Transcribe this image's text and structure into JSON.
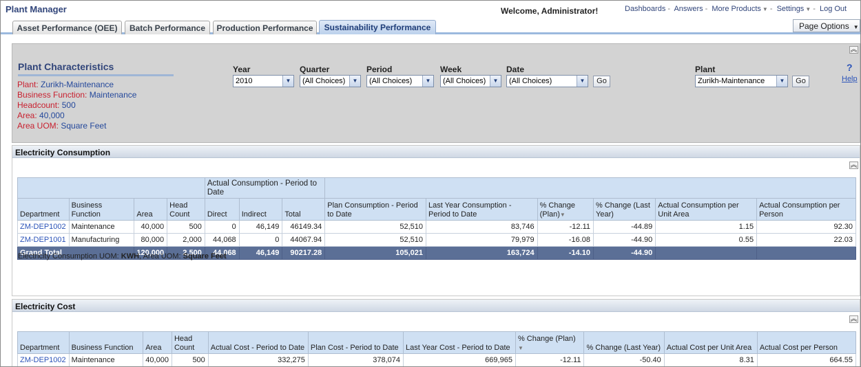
{
  "header": {
    "app_title": "Plant Manager",
    "welcome": "Welcome, Administrator!",
    "links": [
      {
        "label": "Dashboards"
      },
      {
        "label": "Answers"
      },
      {
        "label": "More Products",
        "dropdown": true
      },
      {
        "label": "Settings",
        "dropdown": true
      },
      {
        "label": "Log Out"
      }
    ]
  },
  "tabs": [
    {
      "label": "Asset Performance (OEE)",
      "active": false
    },
    {
      "label": "Batch Performance",
      "active": false
    },
    {
      "label": "Production Performance",
      "active": false
    },
    {
      "label": "Sustainability Performance",
      "active": true
    }
  ],
  "page_options": "Page Options",
  "prompts": {
    "title": "Plant Characteristics",
    "characteristics": [
      {
        "key": "Plant:",
        "value": "Zurikh-Maintenance"
      },
      {
        "key": "Business Function:",
        "value": "Maintenance"
      },
      {
        "key": "Headcount:",
        "value": "500"
      },
      {
        "key": "Area:",
        "value": "40,000"
      },
      {
        "key": "Area UOM:",
        "value": "Square Feet"
      }
    ],
    "filters": [
      {
        "label": "Year",
        "value": "2010"
      },
      {
        "label": "Quarter",
        "value": "(All Choices)"
      },
      {
        "label": "Period",
        "value": "(All Choices)"
      },
      {
        "label": "Week",
        "value": "(All Choices)"
      },
      {
        "label": "Date",
        "value": "(All Choices)"
      }
    ],
    "go_label": "Go",
    "plant_filter": {
      "label": "Plant",
      "value": "Zurikh-Maintenance"
    },
    "help_symbol": "?",
    "help_label": "Help"
  },
  "electricity_consumption": {
    "title": "Electricity Consumption",
    "group_header": "Actual Consumption - Period to Date",
    "columns": [
      "Department",
      "Business Function",
      "Area",
      "Head Count",
      "Direct",
      "Indirect",
      "Total",
      "Plan Consumption - Period to Date",
      "Last Year Consumption - Period to Date",
      "% Change (Plan)",
      "% Change (Last Year)",
      "Actual Consumption per Unit Area",
      "Actual Consumption per Person"
    ],
    "rows": [
      [
        "ZM-DEP1002",
        "Maintenance",
        "40,000",
        "500",
        "0",
        "46,149",
        "46149.34",
        "52,510",
        "83,746",
        "-12.11",
        "-44.89",
        "1.15",
        "92.30"
      ],
      [
        "ZM-DEP1001",
        "Manufacturing",
        "80,000",
        "2,000",
        "44,068",
        "0",
        "44067.94",
        "52,510",
        "79,979",
        "-16.08",
        "-44.90",
        "0.55",
        "22.03"
      ]
    ],
    "grand_total": [
      "Grand Total",
      "120,000",
      "2,500",
      "44,068",
      "46,149",
      "90217.28",
      "105,021",
      "163,724",
      "-14.10",
      "-44.90"
    ],
    "uom_prefix": "Electricity Consumption UOM:",
    "uom_value": "KWH",
    "area_uom_prefix": ", Area UOM:",
    "area_uom_value": "Square Feet"
  },
  "electricity_cost": {
    "title": "Electricity Cost",
    "columns": [
      "Department",
      "Business Function",
      "Area",
      "Head Count",
      "Actual Cost - Period to Date",
      "Plan Cost - Period to Date",
      "Last Year Cost - Period to Date",
      "% Change (Plan)",
      "% Change (Last Year)",
      "Actual Cost per Unit Area",
      "Actual Cost per Person"
    ],
    "rows": [
      [
        "ZM-DEP1002",
        "Maintenance",
        "40,000",
        "500",
        "332,275",
        "378,074",
        "669,965",
        "-12.11",
        "-50.40",
        "8.31",
        "664.55"
      ]
    ]
  },
  "colors": {
    "brand_navy": "#31457a",
    "characteristic_key": "#c8202f",
    "characteristic_value": "#24489b",
    "link": "#2b53b8",
    "header_cell": "#cfe0f3",
    "grand_total_row": "#5b6f96"
  }
}
